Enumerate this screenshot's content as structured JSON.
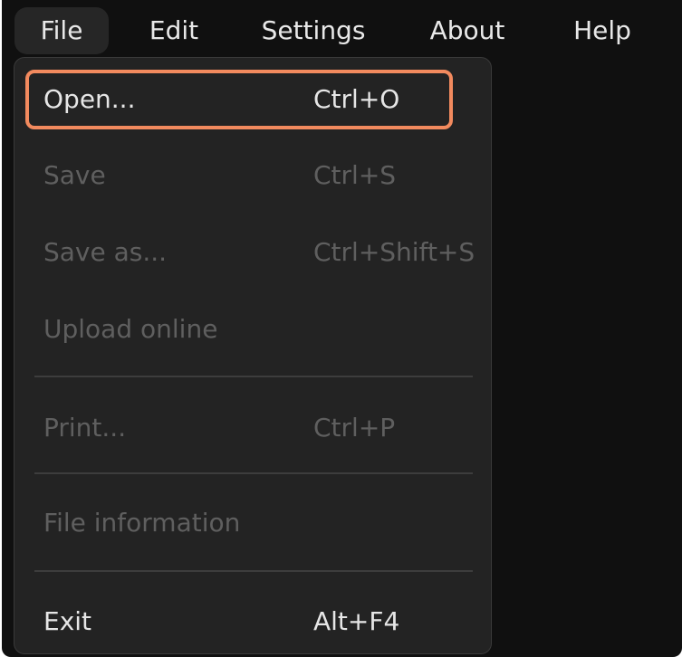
{
  "menubar": {
    "items": [
      {
        "label": "File"
      },
      {
        "label": "Edit"
      },
      {
        "label": "Settings"
      },
      {
        "label": "About"
      },
      {
        "label": "Help"
      }
    ]
  },
  "file_menu": {
    "items": [
      {
        "label": "Open...",
        "shortcut": "Ctrl+O",
        "enabled": true,
        "highlighted": true
      },
      {
        "label": "Save",
        "shortcut": "Ctrl+S",
        "enabled": false
      },
      {
        "label": "Save as...",
        "shortcut": "Ctrl+Shift+S",
        "enabled": false
      },
      {
        "label": "Upload online",
        "shortcut": "",
        "enabled": false
      },
      {
        "label": "Print...",
        "shortcut": "Ctrl+P",
        "enabled": false
      },
      {
        "label": "File information",
        "shortcut": "",
        "enabled": false
      },
      {
        "label": "Exit",
        "shortcut": "Alt+F4",
        "enabled": true
      }
    ]
  },
  "colors": {
    "background": "#101010",
    "menu_background": "#232323",
    "highlight_border": "#f28a5e",
    "enabled_text": "#e6e6e6",
    "disabled_text": "#5f5f5f"
  }
}
